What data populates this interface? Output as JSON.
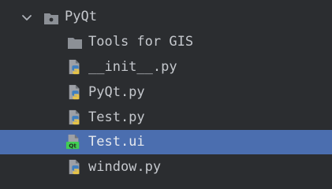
{
  "project_tree": {
    "folder": {
      "name": "PyQt",
      "expanded": true
    },
    "items": [
      {
        "label": "Tools for GIS",
        "icon": "folder-icon"
      },
      {
        "label": "__init__.py",
        "icon": "python-file-icon"
      },
      {
        "label": "PyQt.py",
        "icon": "python-file-icon"
      },
      {
        "label": "Test.py",
        "icon": "python-file-icon"
      },
      {
        "label": "Test.ui",
        "icon": "qt-ui-file-icon",
        "selected": true
      },
      {
        "label": "window.py",
        "icon": "python-file-icon"
      }
    ]
  },
  "colors": {
    "background": "#2b2d30",
    "selection": "#4b6eaf",
    "text": "#c5c8cd",
    "folder": "#8c9096",
    "python_blue": "#3f7fbf",
    "python_yellow": "#e7c447",
    "qt_green": "#41cd52"
  }
}
